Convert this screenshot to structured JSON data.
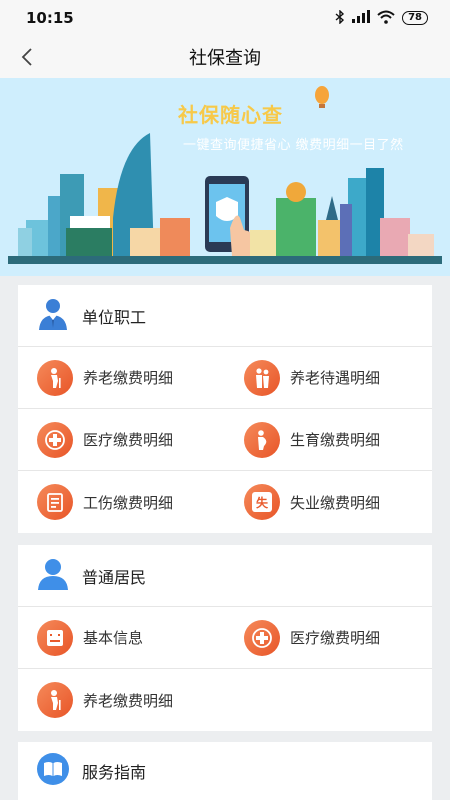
{
  "status_bar": {
    "time": "10:15",
    "battery": "78"
  },
  "header": {
    "title": "社保查询"
  },
  "banner": {
    "title": "社保随心查",
    "subtitle": "一键查询便捷省心  缴费明细一目了然",
    "phone_badge": "保"
  },
  "sections": [
    {
      "title": "单位职工",
      "items": [
        "养老缴费明细",
        "养老待遇明细",
        "医疗缴费明细",
        "生育缴费明细",
        "工伤缴费明细",
        "失业缴费明细"
      ]
    },
    {
      "title": "普通居民",
      "items": [
        "基本信息",
        "医疗缴费明细",
        "养老缴费明细"
      ]
    },
    {
      "title": "服务指南"
    }
  ],
  "icon_glyphs": {
    "unemployment": "失"
  },
  "colors": {
    "accent_orange": "#ec6233",
    "accent_blue": "#3f8fe8",
    "banner_yellow": "#f7c949"
  }
}
